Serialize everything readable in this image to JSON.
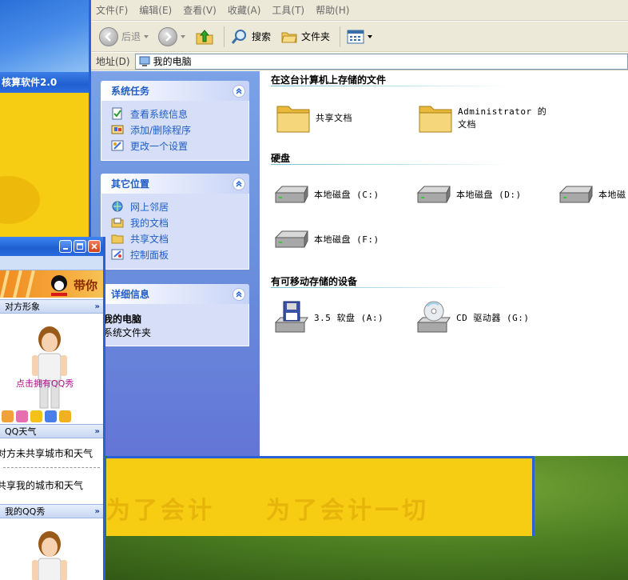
{
  "background_app": {
    "title": "核算软件2.0",
    "slogan_1": "为了会计",
    "slogan_2": "为了会计一切"
  },
  "menubar": {
    "items": [
      "文件(F)",
      "编辑(E)",
      "查看(V)",
      "收藏(A)",
      "工具(T)",
      "帮助(H)"
    ]
  },
  "toolbar": {
    "back_label": "后退",
    "search_label": "搜索",
    "folders_label": "文件夹"
  },
  "addressbar": {
    "label": "地址(D)",
    "value": "我的电脑"
  },
  "taskpane": {
    "system_tasks": {
      "title": "系统任务",
      "links": [
        "查看系统信息",
        "添加/删除程序",
        "更改一个设置"
      ]
    },
    "other_places": {
      "title": "其它位置",
      "links": [
        "网上邻居",
        "我的文档",
        "共享文档",
        "控制面板"
      ]
    },
    "details": {
      "title": "详细信息",
      "name": "我的电脑",
      "type": "系统文件夹"
    }
  },
  "content": {
    "group_files": {
      "header": "在这台计算机上存储的文件",
      "items": [
        "共享文档",
        "Administrator 的文档"
      ]
    },
    "group_drives": {
      "header": "硬盘",
      "items": [
        "本地磁盘 (C:)",
        "本地磁盘 (D:)",
        "本地磁",
        "本地磁盘 (F:)"
      ]
    },
    "group_removable": {
      "header": "有可移动存储的设备",
      "items": [
        "3.5 软盘 (A:)",
        "CD 驱动器 (G:)"
      ]
    }
  },
  "qq_panel": {
    "banner_text": "带你",
    "section_partner": "对方形象",
    "promo": "点击拥有QQ秀",
    "section_weather": "QQ天气",
    "weather_partner": "对方未共享城市和天气",
    "weather_mine": "共享我的城市和天气",
    "section_myshow": "我的QQ秀",
    "chevron": "»"
  },
  "colors": {
    "xp_blue": "#2a62d6",
    "task_link": "#215dc6",
    "menu_bg": "#ece9d8",
    "yellow_app": "#f6cd12"
  }
}
